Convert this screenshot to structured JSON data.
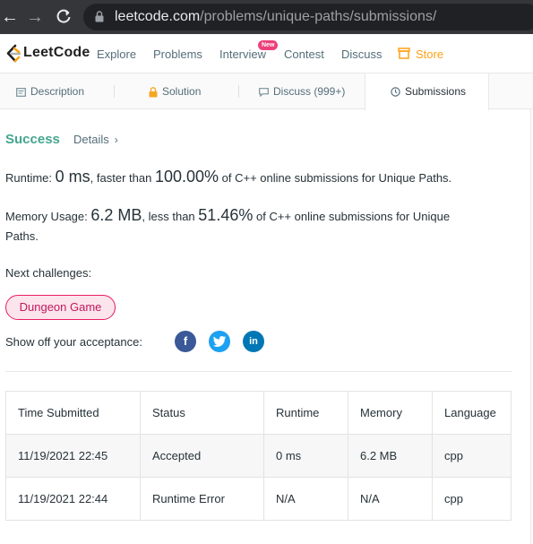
{
  "browser": {
    "url_host": "leetcode.com",
    "url_path": "/problems/unique-paths/submissions/"
  },
  "nav": {
    "logo_text": "LeetCode",
    "links": [
      "Explore",
      "Problems",
      "Interview",
      "Contest",
      "Discuss",
      "Store"
    ],
    "interview_badge": "New"
  },
  "tabs": [
    "Description",
    "Solution",
    "Discuss (999+)",
    "Submissions"
  ],
  "result": {
    "status": "Success",
    "details_label": "Details",
    "runtime_label": "Runtime:",
    "runtime_value": "0 ms",
    "runtime_faster": ", faster than",
    "runtime_percent": "100.00%",
    "runtime_tail": "of C++ online submissions for Unique Paths.",
    "memory_label": "Memory Usage:",
    "memory_value": "6.2 MB",
    "memory_less": ", less than",
    "memory_percent": "51.46%",
    "memory_tail": "of C++ online submissions for Unique",
    "memory_tail2": "Paths."
  },
  "next": {
    "label": "Next challenges:",
    "challenge": "Dungeon Game"
  },
  "share": {
    "label": "Show off your acceptance:",
    "icons": [
      "facebook-icon",
      "twitter-icon",
      "linkedin-icon"
    ]
  },
  "table": {
    "headers": [
      "Time Submitted",
      "Status",
      "Runtime",
      "Memory",
      "Language"
    ],
    "rows": [
      [
        "11/19/2021 22:45",
        "Accepted",
        "0 ms",
        "6.2 MB",
        "cpp"
      ],
      [
        "11/19/2021 22:44",
        "Runtime Error",
        "N/A",
        "N/A",
        "cpp"
      ]
    ]
  },
  "colors": {
    "accent_success": "#43a68e",
    "error": "#c62828",
    "store": "#ffa116",
    "chip_border": "#e91e63"
  }
}
